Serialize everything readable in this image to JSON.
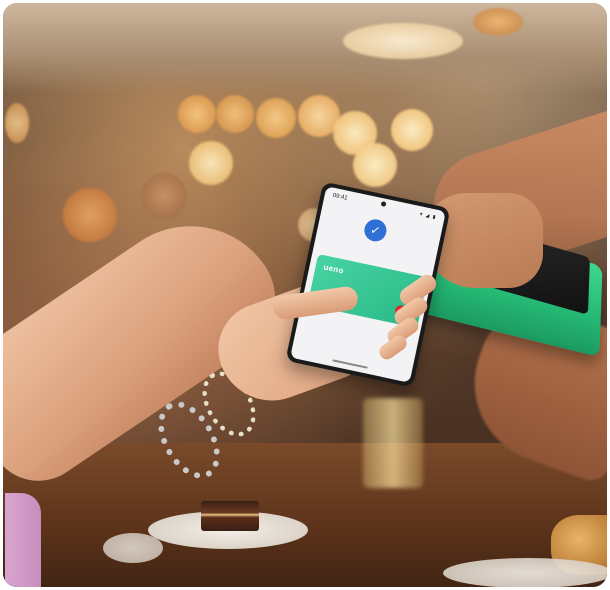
{
  "scene": {
    "description_tags": [
      "contactless-payment",
      "restaurant"
    ]
  },
  "phone": {
    "status_time": "09:41",
    "status_icons": "▾ ◢ ▮",
    "check_icon": "check-icon",
    "card_brand": "ueno",
    "card_network_icon": "mastercard-logo"
  },
  "colors": {
    "card": "#27b986",
    "terminal": "#25b874",
    "check_badge": "#2f6fd6"
  }
}
